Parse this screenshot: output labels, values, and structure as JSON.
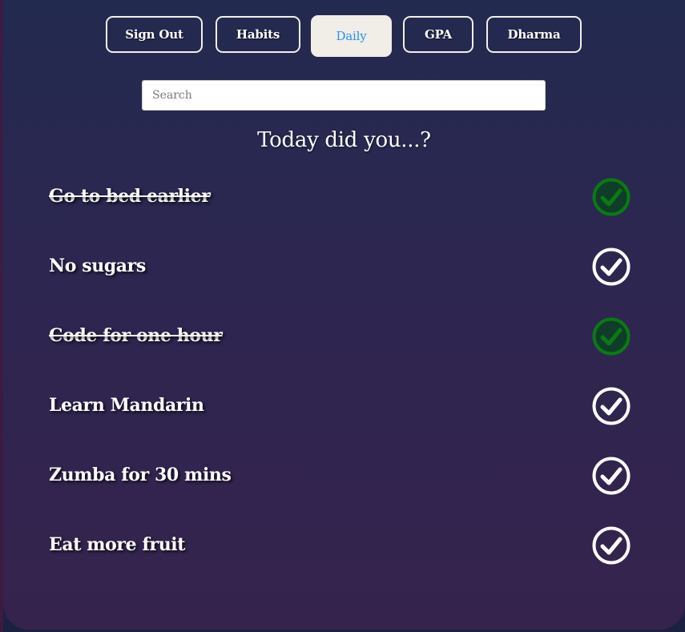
{
  "nav": {
    "buttons": [
      {
        "label": "Sign Out",
        "active": false
      },
      {
        "label": "Habits",
        "active": false
      },
      {
        "label": "Daily",
        "active": true
      },
      {
        "label": "GPA",
        "active": false
      },
      {
        "label": "Dharma",
        "active": false
      }
    ]
  },
  "search": {
    "placeholder": "Search",
    "value": ""
  },
  "heading": "Today did you...?",
  "habits": [
    {
      "label": "Go to bed earlier",
      "completed": true
    },
    {
      "label": "No sugars",
      "completed": false
    },
    {
      "label": "Code for one hour",
      "completed": true
    },
    {
      "label": "Learn Mandarin",
      "completed": false
    },
    {
      "label": "Zumba for 30 mins",
      "completed": false
    },
    {
      "label": "Eat more fruit",
      "completed": false
    }
  ],
  "colors": {
    "active_tab_text": "#2b93f0",
    "active_tab_bg": "#f1ede7",
    "check_done": "#0a7a12",
    "check_done_bg": "#0f3d2a",
    "check_todo": "#ffffff",
    "panel_top": "#232a4f",
    "panel_bottom": "#35234d"
  },
  "icons": {
    "check": "check-circle-icon"
  }
}
